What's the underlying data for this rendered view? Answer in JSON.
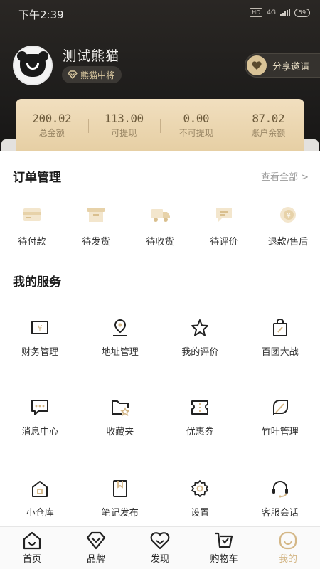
{
  "status": {
    "time": "下午2:39",
    "hd": "HD",
    "net": "4G",
    "battery": "59"
  },
  "profile": {
    "name": "测试熊猫",
    "rank": "熊猫中将",
    "share_label": "分享邀请"
  },
  "wallet": [
    {
      "value": "200.02",
      "label": "总金额"
    },
    {
      "value": "113.00",
      "label": "可提现"
    },
    {
      "value": "0.00",
      "label": "不可提现"
    },
    {
      "value": "87.02",
      "label": "账户余额"
    }
  ],
  "orders": {
    "title": "订单管理",
    "view_all": "查看全部 >",
    "items": [
      {
        "label": "待付款",
        "icon": "card-icon"
      },
      {
        "label": "待发货",
        "icon": "box-icon"
      },
      {
        "label": "待收货",
        "icon": "truck-icon"
      },
      {
        "label": "待评价",
        "icon": "comment-icon"
      },
      {
        "label": "退款/售后",
        "icon": "refund-icon"
      }
    ]
  },
  "services": {
    "title": "我的服务",
    "items": [
      {
        "label": "财务管理",
        "icon": "finance-icon"
      },
      {
        "label": "地址管理",
        "icon": "location-icon"
      },
      {
        "label": "我的评价",
        "icon": "star-icon"
      },
      {
        "label": "百团大战",
        "icon": "bag-icon"
      },
      {
        "label": "消息中心",
        "icon": "message-icon"
      },
      {
        "label": "收藏夹",
        "icon": "folder-star-icon"
      },
      {
        "label": "优惠券",
        "icon": "coupon-icon"
      },
      {
        "label": "竹叶管理",
        "icon": "leaf-icon"
      },
      {
        "label": "小仓库",
        "icon": "warehouse-icon"
      },
      {
        "label": "笔记发布",
        "icon": "notebook-icon"
      },
      {
        "label": "设置",
        "icon": "gear-icon"
      },
      {
        "label": "客服会话",
        "icon": "headset-icon"
      }
    ]
  },
  "tabs": [
    {
      "label": "首页",
      "icon": "home-icon"
    },
    {
      "label": "品牌",
      "icon": "diamond-icon"
    },
    {
      "label": "发现",
      "icon": "heart-icon"
    },
    {
      "label": "购物车",
      "icon": "cart-icon"
    },
    {
      "label": "我的",
      "icon": "profile-icon",
      "active": true
    }
  ],
  "colors": {
    "accent": "#D4B787",
    "dark": "#1C1B1A",
    "wallet": "#EBD5AE"
  }
}
